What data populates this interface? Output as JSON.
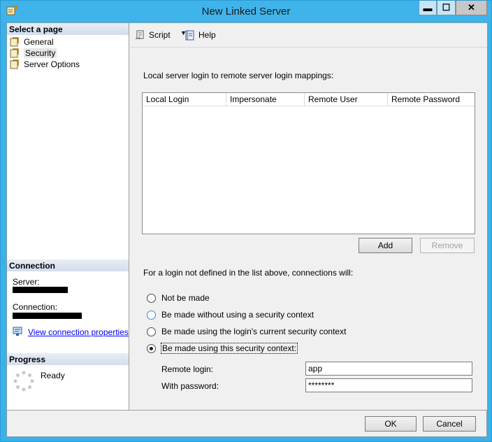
{
  "window": {
    "title": "New Linked Server",
    "controls": {
      "minimize": "▬",
      "maximize": "☐",
      "close": "✕"
    }
  },
  "left_pane": {
    "select_page_heading": "Select a page",
    "pages": [
      {
        "label": "General",
        "icon": "page-icon",
        "selected": false
      },
      {
        "label": "Security",
        "icon": "page-icon",
        "selected": true
      },
      {
        "label": "Server Options",
        "icon": "page-icon",
        "selected": false
      }
    ],
    "connection_heading": "Connection",
    "server_label": "Server:",
    "connection_label": "Connection:",
    "view_connection_link": "View connection properties",
    "progress_heading": "Progress",
    "progress_status": "Ready"
  },
  "toolbar": {
    "script_label": "Script",
    "script_dropdown": "▼",
    "help_label": "Help"
  },
  "mappings": {
    "heading": "Local server login to remote server login mappings:",
    "columns": [
      "Local Login",
      "Impersonate",
      "Remote User",
      "Remote Password"
    ],
    "rows": [],
    "add_label": "Add",
    "remove_label": "Remove"
  },
  "security_context": {
    "heading": "For a login not defined in the list above, connections will:",
    "options": [
      {
        "label": "Not be made",
        "checked": false
      },
      {
        "label": "Be made without using a security context",
        "checked": false
      },
      {
        "label": "Be made using the login's current security context",
        "checked": false
      },
      {
        "label": "Be made using this security context:",
        "checked": true
      }
    ],
    "remote_login_label": "Remote login:",
    "remote_login_value": "app",
    "password_label": "With password:",
    "password_value": "********"
  },
  "footer": {
    "ok_label": "OK",
    "cancel_label": "Cancel"
  },
  "colors": {
    "title_bar": "#3fb4ea",
    "link": "#0000ee",
    "section_header": "#d3ddec"
  }
}
